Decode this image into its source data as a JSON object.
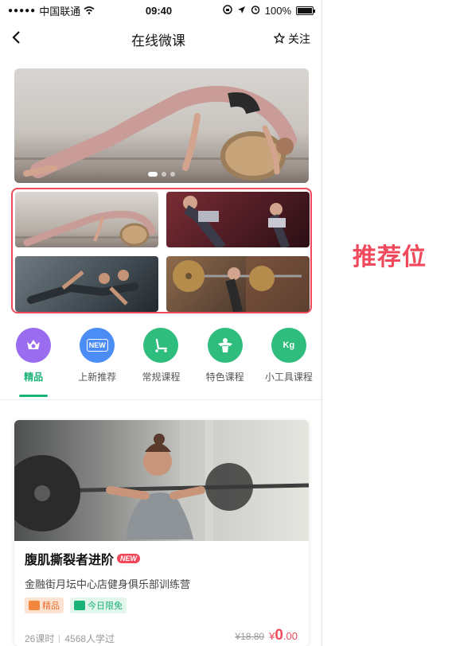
{
  "status_bar": {
    "carrier": "中国联通",
    "time": "09:40",
    "battery": "100%",
    "battery_level": 1.0
  },
  "nav": {
    "title": "在线微课",
    "follow_label": "关注"
  },
  "banner": {
    "pages": 3,
    "active_page": 1
  },
  "annotation": "推荐位",
  "categories": [
    {
      "label": "精品",
      "icon": "crown-heart-icon",
      "color": "#9a6cf0"
    },
    {
      "label": "上新推荐",
      "icon": "new-badge-icon",
      "color": "#4b8cf5",
      "icon_text": "NEW"
    },
    {
      "label": "常规课程",
      "icon": "treadmill-icon",
      "color": "#2fbd7d"
    },
    {
      "label": "特色课程",
      "icon": "fitness-body-icon",
      "color": "#2fbd7d"
    },
    {
      "label": "小工具课程",
      "icon": "kettlebell-icon",
      "color": "#2fbd7d",
      "icon_text": "Kg"
    }
  ],
  "course": {
    "title": "腹肌撕裂者进阶",
    "new_badge": "NEW",
    "subtitle": "金融街月坛中心店健身俱乐部训练营",
    "tags": [
      "精品",
      "今日限免"
    ],
    "lessons": "26课时",
    "learners": "4568人学过",
    "old_price": "¥18.80",
    "price_symbol": "¥",
    "price_int": "0",
    "price_dec": ".00"
  },
  "colors": {
    "accent": "#19b277",
    "highlight": "#f0495b"
  }
}
